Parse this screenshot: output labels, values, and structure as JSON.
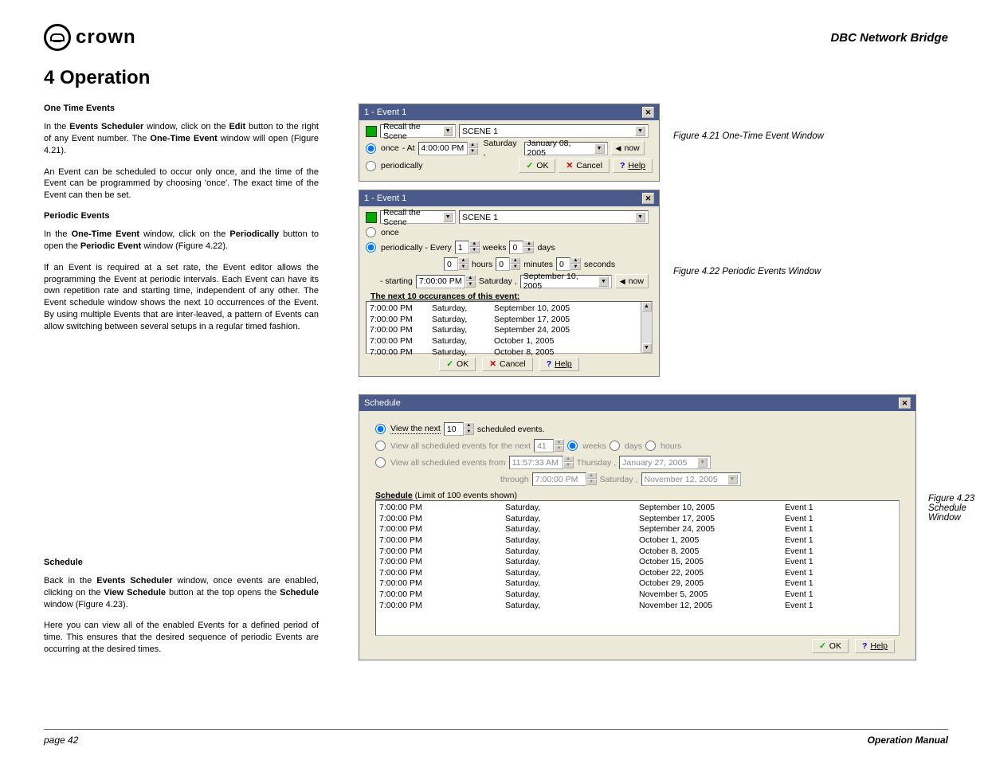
{
  "header": {
    "brand": "crown",
    "right": "DBC Network Bridge"
  },
  "section_title": "4 Operation",
  "figs": {
    "f421": "Figure 4.21  One-Time Event Window",
    "f422": "Figure 4.22  Periodic Events Window",
    "f423a": "Figure 4.23",
    "f423b": "Schedule",
    "f423c": "Window"
  },
  "text": {
    "h1": "One Time Events",
    "p1a": "In the ",
    "p1b": "Events Scheduler",
    "p1c": " window, click on the ",
    "p1d": "Edit",
    "p1e": " button to the right of any Event number. The ",
    "p1f": "One-Time Event",
    "p1g": " window will open (Figure 4.21).",
    "p2": "An Event can be scheduled to occur only once, and the time of the Event can be programmed by choosing 'once'. The exact time of the Event can then be set.",
    "h2": "Periodic Events",
    "p3a": "In the ",
    "p3b": "One-Time Event",
    "p3c": " window, click on the ",
    "p3d": "Periodically",
    "p3e": " button to open the ",
    "p3f": "Periodic Event",
    "p3g": " window (Figure 4.22).",
    "p4": "If an Event is required at a set rate, the Event editor allows the programming the Event at periodic intervals. Each Event can have its own repetition rate and starting time, independent of any other. The Event schedule window shows the next 10 occurrences of the Event. By using multiple Events that are inter-leaved, a pattern of Events can allow switching between several setups in a regular timed fashion.",
    "h3": "Schedule",
    "p5a": "Back in the ",
    "p5b": "Events Scheduler",
    "p5c": " window, once events are enabled, clicking on the ",
    "p5d": "View Schedule",
    "p5e": " button at the top opens the ",
    "p5f": "Schedule",
    "p5g": " window (Figure 4.23).",
    "p6": "Here you can view all of the enabled Events for a defined period of time. This ensures that the desired sequence of periodic Events are occurring at the desired times."
  },
  "win1": {
    "title": "1 - Event 1",
    "action": "Recall the Scene",
    "scene": "SCENE 1",
    "once": "once",
    "at": "- At",
    "time": "4:00:00 PM",
    "day": "Saturday ,",
    "date": "January  08, 2005",
    "now": "now",
    "periodically": "periodically",
    "ok": "OK",
    "cancel": "Cancel",
    "help": "Help"
  },
  "win2": {
    "title": "1 - Event 1",
    "action": "Recall the Scene",
    "scene": "SCENE 1",
    "once": "once",
    "per": "periodically - Every",
    "w": "1",
    "weeks": "weeks",
    "d": "0",
    "days": "days",
    "h": "0",
    "hours": "hours",
    "m": "0",
    "minutes": "minutes",
    "s": "0",
    "seconds": "seconds",
    "starting": "- starting",
    "time": "7:00:00 PM",
    "day": "Saturday  ,",
    "date": "September 10, 2005",
    "now": "now",
    "next_label": "The next 10 occurances of this event:",
    "occ": [
      [
        "7:00:00 PM",
        "Saturday,",
        "September 10, 2005"
      ],
      [
        "7:00:00 PM",
        "Saturday,",
        "September 17, 2005"
      ],
      [
        "7:00:00 PM",
        "Saturday,",
        "September 24, 2005"
      ],
      [
        "7:00:00 PM",
        "Saturday,",
        "October 1, 2005"
      ],
      [
        "7:00:00 PM",
        "Saturday,",
        "October 8, 2005"
      ]
    ],
    "ok": "OK",
    "cancel": "Cancel",
    "help": "Help"
  },
  "win3": {
    "title": "Schedule",
    "r1a": "View the next",
    "r1n": "10",
    "r1b": "scheduled events.",
    "r2a": "View all scheduled events for the next",
    "r2n": "41",
    "r2w": "weeks",
    "r2d": "days",
    "r2h": "hours",
    "r3a": "View all scheduled events from",
    "r3t": "11:57:33 AM",
    "r3d": "Thursday ,",
    "r3date": "January  27, 2005",
    "r4a": "through",
    "r4t": "7:00:00 PM",
    "r4d": "Saturday ,",
    "r4date": "November 12, 2005",
    "listhead": "Schedule",
    "listhead2": " (Limit of 100 events shown)",
    "rows": [
      [
        "7:00:00 PM",
        "Saturday,",
        "September 10, 2005",
        "Event 1"
      ],
      [
        "7:00:00 PM",
        "Saturday,",
        "September 17, 2005",
        "Event 1"
      ],
      [
        "7:00:00 PM",
        "Saturday,",
        "September 24, 2005",
        "Event 1"
      ],
      [
        "7:00:00 PM",
        "Saturday,",
        "October 1, 2005",
        "Event 1"
      ],
      [
        "7:00:00 PM",
        "Saturday,",
        "October 8, 2005",
        "Event 1"
      ],
      [
        "7:00:00 PM",
        "Saturday,",
        "October 15, 2005",
        "Event 1"
      ],
      [
        "7:00:00 PM",
        "Saturday,",
        "October 22, 2005",
        "Event 1"
      ],
      [
        "7:00:00 PM",
        "Saturday,",
        "October 29, 2005",
        "Event 1"
      ],
      [
        "7:00:00 PM",
        "Saturday,",
        "November 5, 2005",
        "Event 1"
      ],
      [
        "7:00:00 PM",
        "Saturday,",
        "November 12, 2005",
        "Event 1"
      ]
    ],
    "ok": "OK",
    "help": "Help"
  },
  "footer": {
    "left": "page 42",
    "right": "Operation Manual"
  }
}
